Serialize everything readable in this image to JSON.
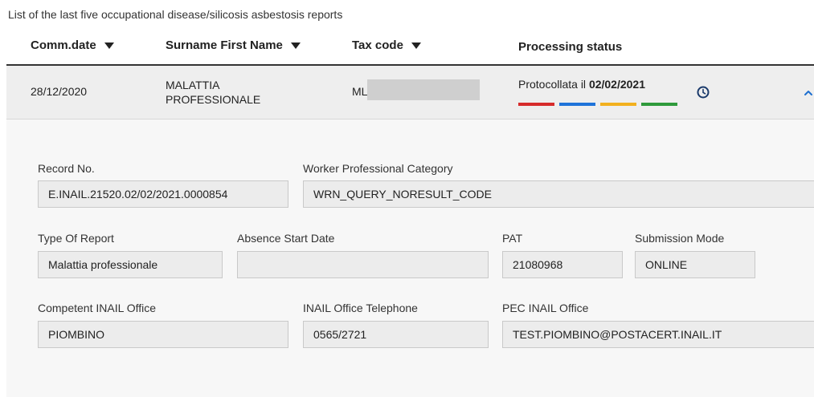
{
  "caption": "List of the last five occupational disease/silicosis asbestosis reports",
  "table": {
    "headers": {
      "comm_date": "Comm.date",
      "surname": "Surname First Name",
      "tax_code": "Tax code",
      "status": "Processing status"
    },
    "row": {
      "comm_date": "28/12/2020",
      "name_line1": "MALATTIA",
      "name_line2": "PROFESSIONALE",
      "tax_code_visible": "ML",
      "status_prefix": "Protocollata il ",
      "status_date": "02/02/2021",
      "status_colors": [
        "#d62b2b",
        "#1e73d9",
        "#f2b01e",
        "#2e9a3b"
      ]
    }
  },
  "details": {
    "record_no": {
      "label": "Record No.",
      "value": "E.INAIL.21520.02/02/2021.0000854"
    },
    "worker_category": {
      "label": "Worker Professional Category",
      "value": "WRN_QUERY_NORESULT_CODE"
    },
    "type_of_report": {
      "label": "Type Of Report",
      "value": "Malattia professionale"
    },
    "absence_start": {
      "label": "Absence Start Date",
      "value": ""
    },
    "pat": {
      "label": "PAT",
      "value": "21080968"
    },
    "submission_mode": {
      "label": "Submission Mode",
      "value": "ONLINE"
    },
    "office": {
      "label": "Competent INAIL Office",
      "value": "PIOMBINO"
    },
    "telephone": {
      "label": "INAIL Office Telephone",
      "value": "0565/2721"
    },
    "pec": {
      "label": "PEC INAIL Office",
      "value": "TEST.PIOMBINO@POSTACERT.INAIL.IT"
    }
  },
  "icons": {
    "history": "clock-icon",
    "collapse": "chevron-up-icon",
    "sort": "sort-triangle-icon"
  }
}
